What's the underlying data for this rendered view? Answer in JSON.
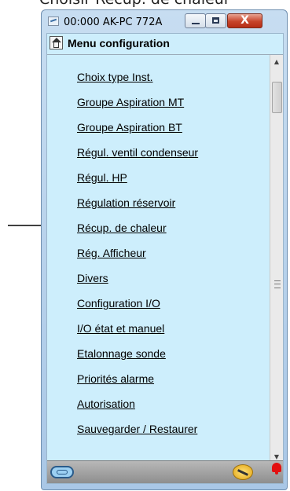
{
  "caption": "Choisir Récup. de chaleur",
  "window": {
    "title": "00:000 AK-PC 772A",
    "controls": {
      "minimize": "",
      "maximize": "",
      "close": "X"
    }
  },
  "header": {
    "title": "Menu configuration"
  },
  "menu": {
    "items": [
      "Choix type Inst.",
      "Groupe Aspiration MT",
      "Groupe Aspiration BT",
      "Régul. ventil condenseur",
      "Régul. HP",
      "Régulation réservoir",
      "Récup. de chaleur",
      "Rég. Afficheur",
      "Divers",
      "Configuration I/O",
      "I/O  état et manuel",
      "Etalonnage sonde",
      "Priorités alarme",
      "Autorisation",
      "Sauvegarder / Restaurer"
    ],
    "highlighted_item": "Récup. de chaleur"
  },
  "icons": {
    "window": "app-icon",
    "home": "home-icon",
    "footer_left": "key-icon",
    "footer_right": "wrench-icon",
    "alarm": "alarm-bell-icon",
    "pointer": "pointer-arrow"
  },
  "colors": {
    "client_background": "#cdeefc",
    "close_button": "#c7432a",
    "alarm": "#e31010",
    "arrow": "#000000"
  }
}
